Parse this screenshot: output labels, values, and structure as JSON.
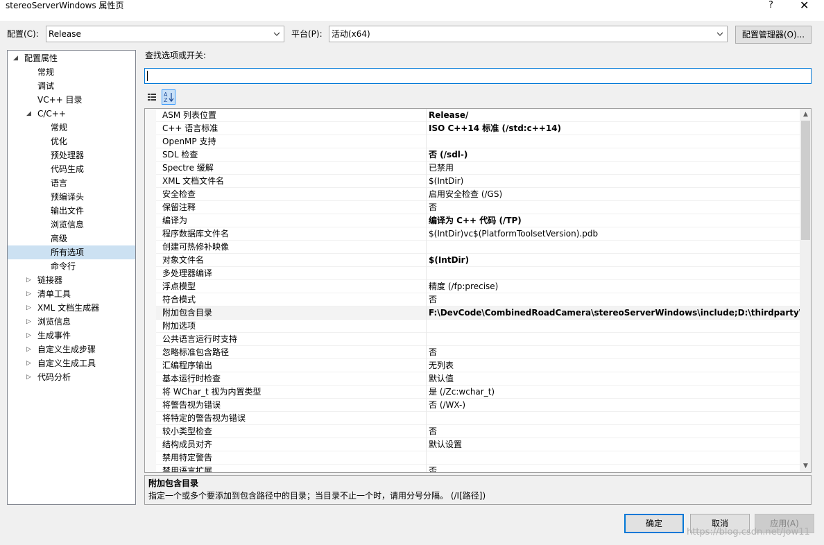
{
  "window": {
    "title": "stereoServerWindows 属性页",
    "help_label": "?",
    "close_label": "✕"
  },
  "config": {
    "config_label": "配置(C):",
    "config_value": "Release",
    "platform_label": "平台(P):",
    "platform_value": "活动(x64)",
    "manager_button": "配置管理器(O)..."
  },
  "tree": {
    "items": [
      {
        "label": "配置属性",
        "expander": "◢",
        "level": 0
      },
      {
        "label": "常规",
        "expander": "",
        "level": 1
      },
      {
        "label": "调试",
        "expander": "",
        "level": 1
      },
      {
        "label": "VC++ 目录",
        "expander": "",
        "level": 1
      },
      {
        "label": "C/C++",
        "expander": "◢",
        "level": 1
      },
      {
        "label": "常规",
        "expander": "",
        "level": 2
      },
      {
        "label": "优化",
        "expander": "",
        "level": 2
      },
      {
        "label": "预处理器",
        "expander": "",
        "level": 2
      },
      {
        "label": "代码生成",
        "expander": "",
        "level": 2
      },
      {
        "label": "语言",
        "expander": "",
        "level": 2
      },
      {
        "label": "预编译头",
        "expander": "",
        "level": 2
      },
      {
        "label": "输出文件",
        "expander": "",
        "level": 2
      },
      {
        "label": "浏览信息",
        "expander": "",
        "level": 2
      },
      {
        "label": "高级",
        "expander": "",
        "level": 2
      },
      {
        "label": "所有选项",
        "expander": "",
        "level": 2,
        "selected": true
      },
      {
        "label": "命令行",
        "expander": "",
        "level": 2
      },
      {
        "label": "链接器",
        "expander": "▷",
        "level": 1
      },
      {
        "label": "清单工具",
        "expander": "▷",
        "level": 1
      },
      {
        "label": "XML 文档生成器",
        "expander": "▷",
        "level": 1
      },
      {
        "label": "浏览信息",
        "expander": "▷",
        "level": 1
      },
      {
        "label": "生成事件",
        "expander": "▷",
        "level": 1
      },
      {
        "label": "自定义生成步骤",
        "expander": "▷",
        "level": 1
      },
      {
        "label": "自定义生成工具",
        "expander": "▷",
        "level": 1
      },
      {
        "label": "代码分析",
        "expander": "▷",
        "level": 1
      }
    ]
  },
  "search": {
    "label": "查找选项或开关:",
    "value": ""
  },
  "grid": {
    "rows": [
      {
        "name": "ASM 列表位置",
        "value": "Release/",
        "bold": true
      },
      {
        "name": "C++ 语言标准",
        "value": "ISO C++14 标准 (/std:c++14)",
        "bold": true
      },
      {
        "name": "OpenMP 支持",
        "value": "",
        "bold": false
      },
      {
        "name": "SDL 检查",
        "value": "否 (/sdl-)",
        "bold": true
      },
      {
        "name": "Spectre 缓解",
        "value": "已禁用",
        "bold": false
      },
      {
        "name": "XML 文档文件名",
        "value": "$(IntDir)",
        "bold": false
      },
      {
        "name": "安全检查",
        "value": "启用安全检查 (/GS)",
        "bold": false
      },
      {
        "name": "保留注释",
        "value": "否",
        "bold": false
      },
      {
        "name": "编译为",
        "value": "编译为 C++ 代码 (/TP)",
        "bold": true
      },
      {
        "name": "程序数据库文件名",
        "value": "$(IntDir)vc$(PlatformToolsetVersion).pdb",
        "bold": false
      },
      {
        "name": "创建可热修补映像",
        "value": "",
        "bold": false
      },
      {
        "name": "对象文件名",
        "value": "$(IntDir)",
        "bold": true
      },
      {
        "name": "多处理器编译",
        "value": "",
        "bold": false
      },
      {
        "name": "浮点模型",
        "value": "精度 (/fp:precise)",
        "bold": false
      },
      {
        "name": "符合模式",
        "value": "否",
        "bold": false
      },
      {
        "name": "附加包含目录",
        "value": "F:\\DevCode\\CombinedRoadCamera\\stereoServerWindows\\include;D:\\thirdparty\\build\\",
        "bold": true,
        "highlight": true
      },
      {
        "name": "附加选项",
        "value": "",
        "bold": false
      },
      {
        "name": "公共语言运行时支持",
        "value": "",
        "bold": false
      },
      {
        "name": "忽略标准包含路径",
        "value": "否",
        "bold": false
      },
      {
        "name": "汇编程序输出",
        "value": "无列表",
        "bold": false
      },
      {
        "name": "基本运行时检查",
        "value": "默认值",
        "bold": false
      },
      {
        "name": "将 WChar_t 视为内置类型",
        "value": "是 (/Zc:wchar_t)",
        "bold": false
      },
      {
        "name": "将警告视为错误",
        "value": "否 (/WX-)",
        "bold": false
      },
      {
        "name": "将特定的警告视为错误",
        "value": "",
        "bold": false
      },
      {
        "name": "较小类型检查",
        "value": "否",
        "bold": false
      },
      {
        "name": "结构成员对齐",
        "value": "默认设置",
        "bold": false
      },
      {
        "name": "禁用特定警告",
        "value": "",
        "bold": false
      },
      {
        "name": "禁用语言扩展",
        "value": "否",
        "bold": false
      }
    ]
  },
  "description": {
    "title": "附加包含目录",
    "text": "指定一个或多个要添加到包含路径中的目录；当目录不止一个时，请用分号分隔。     (/I[路径])"
  },
  "buttons": {
    "ok": "确定",
    "cancel": "取消",
    "apply": "应用(A)"
  },
  "watermark": "https://blog.csdn.net/jow11"
}
